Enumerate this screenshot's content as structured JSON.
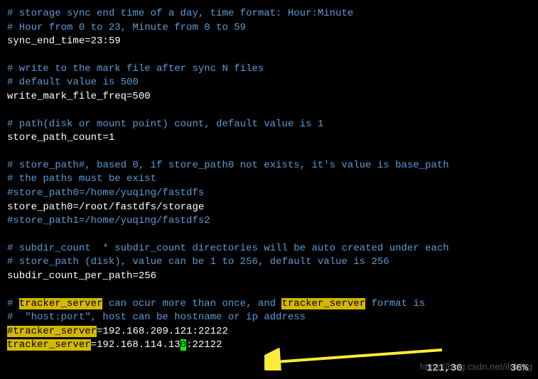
{
  "lines": [
    {
      "type": "comment",
      "text": "# storage sync end time of a day, time format: Hour:Minute"
    },
    {
      "type": "comment",
      "text": "# Hour from 0 to 23, Minute from 0 to 59"
    },
    {
      "type": "code",
      "text": "sync_end_time=23:59"
    },
    {
      "type": "blank"
    },
    {
      "type": "comment",
      "text": "# write to the mark file after sync N files"
    },
    {
      "type": "comment",
      "text": "# default value is 500"
    },
    {
      "type": "code",
      "text": "write_mark_file_freq=500"
    },
    {
      "type": "blank"
    },
    {
      "type": "comment",
      "text": "# path(disk or mount point) count, default value is 1"
    },
    {
      "type": "code",
      "text": "store_path_count=1"
    },
    {
      "type": "blank"
    },
    {
      "type": "comment",
      "text": "# store_path#, based 0, if store_path0 not exists, it's value is base_path"
    },
    {
      "type": "comment",
      "text": "# the paths must be exist"
    },
    {
      "type": "comment",
      "text": "#store_path0=/home/yuqing/fastdfs"
    },
    {
      "type": "code",
      "text": "store_path0=/root/fastdfs/storage"
    },
    {
      "type": "comment",
      "text": "#store_path1=/home/yuqing/fastdfs2"
    },
    {
      "type": "blank"
    },
    {
      "type": "comment",
      "text": "# subdir_count  * subdir_count directories will be auto created under each"
    },
    {
      "type": "comment",
      "text": "# store_path (disk), value can be 1 to 256, default value is 256"
    },
    {
      "type": "code",
      "text": "subdir_count_per_path=256"
    },
    {
      "type": "blank"
    }
  ],
  "tracker_line1": {
    "prefix": "# ",
    "hl1": "tracker_server",
    "mid": " can ocur more than once, and ",
    "hl2": "tracker_server",
    "suffix": " format is"
  },
  "tracker_line2": "#  \"host:port\", host can be hostname or ip address",
  "tracker_line3": {
    "hl": "#tracker_server",
    "rest": "=192.168.209.121:22122"
  },
  "tracker_line4": {
    "hl": "tracker_server",
    "eq_ip_pre": "=192.168.114.13",
    "cursor_char": "0",
    "rest": ":22122"
  },
  "status": {
    "pos": "121,30",
    "pct": "36%"
  },
  "watermark": "https://blog.csdn.net/ifubing"
}
